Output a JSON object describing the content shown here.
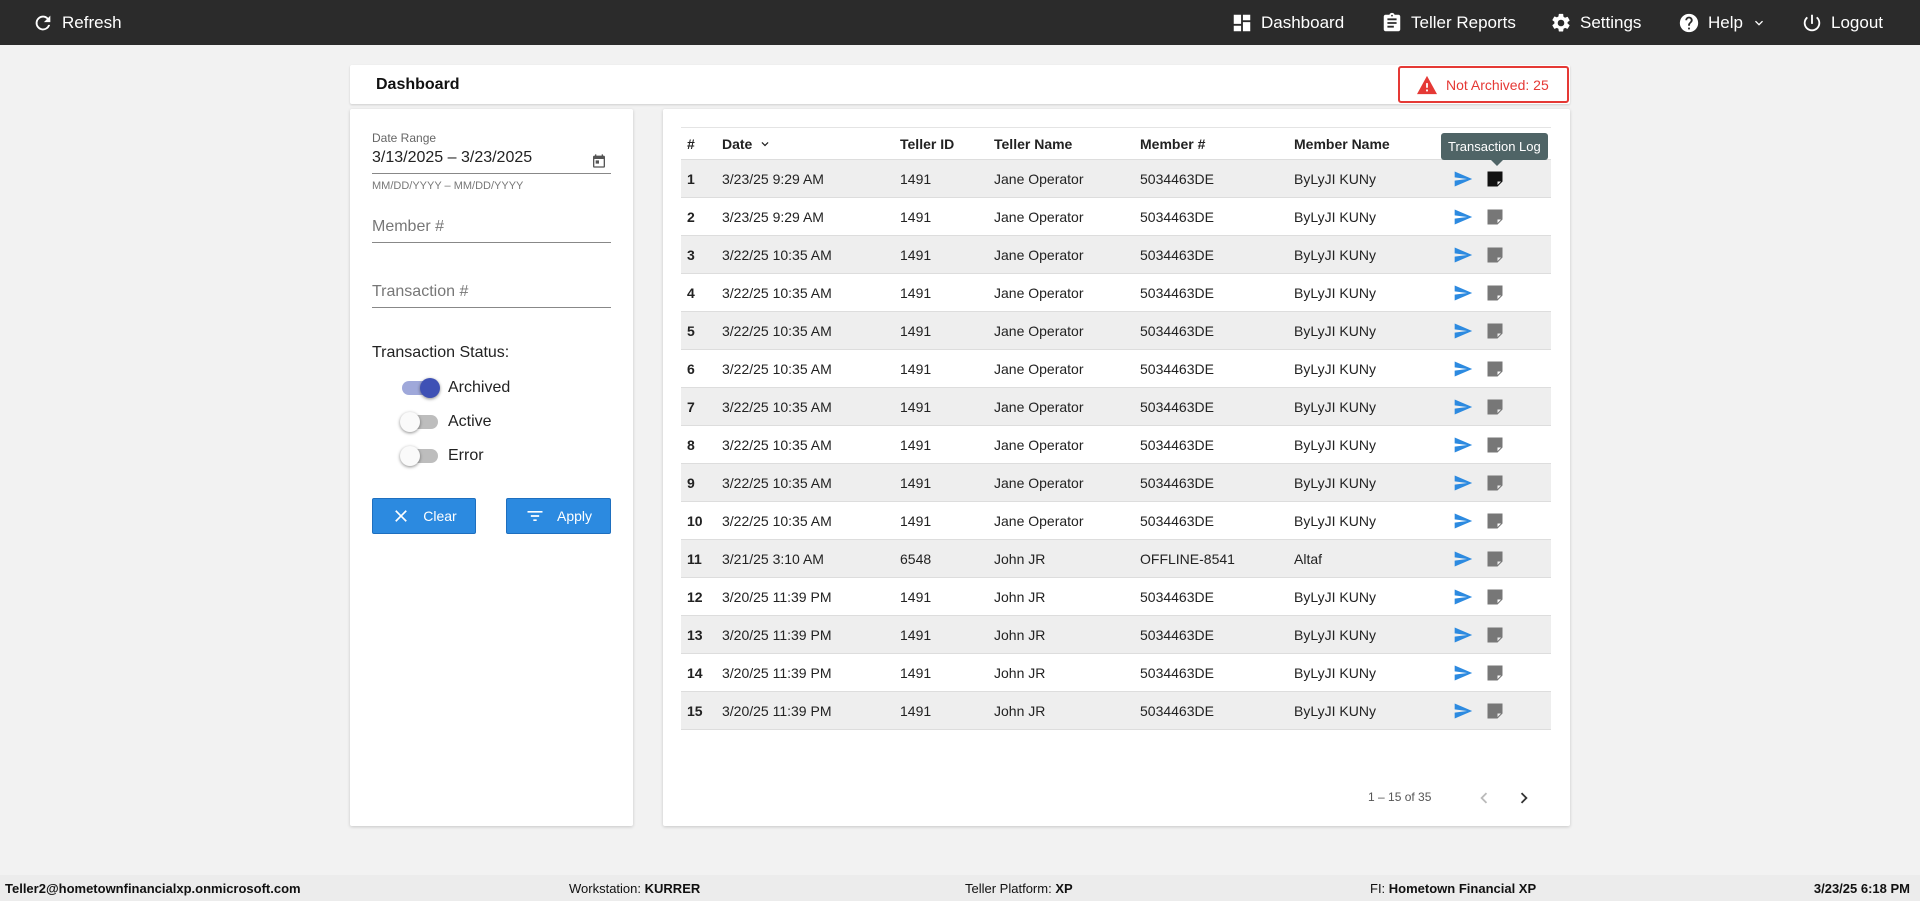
{
  "topbar": {
    "refresh_label": "Refresh",
    "dashboard_label": "Dashboard",
    "teller_reports_label": "Teller Reports",
    "settings_label": "Settings",
    "help_label": "Help",
    "logout_label": "Logout"
  },
  "header": {
    "title": "Dashboard",
    "alert_label": "Not Archived: 25",
    "alert_color": "#e53935"
  },
  "filters": {
    "date_range_label": "Date Range",
    "date_range_value": "3/13/2025 – 3/23/2025",
    "date_range_hint": "MM/DD/YYYY – MM/DD/YYYY",
    "member_placeholder": "Member #",
    "transaction_placeholder": "Transaction #",
    "status_label": "Transaction Status:",
    "statuses": [
      {
        "label": "Archived",
        "on": true
      },
      {
        "label": "Active",
        "on": false
      },
      {
        "label": "Error",
        "on": false
      }
    ],
    "clear_label": "Clear",
    "apply_label": "Apply"
  },
  "table": {
    "columns": [
      "#",
      "Date",
      "Teller ID",
      "Teller Name",
      "Member #",
      "Member Name"
    ],
    "tooltip": "Transaction Log",
    "rows": [
      [
        "1",
        "3/23/25 9:29 AM",
        "1491",
        "Jane Operator",
        "5034463DE",
        "ByLyJI KUNy"
      ],
      [
        "2",
        "3/23/25 9:29 AM",
        "1491",
        "Jane Operator",
        "5034463DE",
        "ByLyJI KUNy"
      ],
      [
        "3",
        "3/22/25 10:35 AM",
        "1491",
        "Jane Operator",
        "5034463DE",
        "ByLyJI KUNy"
      ],
      [
        "4",
        "3/22/25 10:35 AM",
        "1491",
        "Jane Operator",
        "5034463DE",
        "ByLyJI KUNy"
      ],
      [
        "5",
        "3/22/25 10:35 AM",
        "1491",
        "Jane Operator",
        "5034463DE",
        "ByLyJI KUNy"
      ],
      [
        "6",
        "3/22/25 10:35 AM",
        "1491",
        "Jane Operator",
        "5034463DE",
        "ByLyJI KUNy"
      ],
      [
        "7",
        "3/22/25 10:35 AM",
        "1491",
        "Jane Operator",
        "5034463DE",
        "ByLyJI KUNy"
      ],
      [
        "8",
        "3/22/25 10:35 AM",
        "1491",
        "Jane Operator",
        "5034463DE",
        "ByLyJI KUNy"
      ],
      [
        "9",
        "3/22/25 10:35 AM",
        "1491",
        "Jane Operator",
        "5034463DE",
        "ByLyJI KUNy"
      ],
      [
        "10",
        "3/22/25 10:35 AM",
        "1491",
        "Jane Operator",
        "5034463DE",
        "ByLyJI KUNy"
      ],
      [
        "11",
        "3/21/25 3:10 AM",
        "6548",
        "John JR",
        "OFFLINE-8541",
        "Altaf"
      ],
      [
        "12",
        "3/20/25 11:39 PM",
        "1491",
        "John JR",
        "5034463DE",
        "ByLyJI KUNy"
      ],
      [
        "13",
        "3/20/25 11:39 PM",
        "1491",
        "John JR",
        "5034463DE",
        "ByLyJI KUNy"
      ],
      [
        "14",
        "3/20/25 11:39 PM",
        "1491",
        "John JR",
        "5034463DE",
        "ByLyJI KUNy"
      ],
      [
        "15",
        "3/20/25 11:39 PM",
        "1491",
        "John JR",
        "5034463DE",
        "ByLyJI KUNy"
      ]
    ],
    "paginator_label": "1 – 15 of 35"
  },
  "footer": {
    "user": "Teller2@hometownfinancialxp.onmicrosoft.com",
    "workstation_label": "Workstation:",
    "workstation_value": "KURRER",
    "platform_label": "Teller Platform:",
    "platform_value": "XP",
    "fi_label": "FI:",
    "fi_value": "Hometown Financial XP",
    "datetime": "3/23/25 6:18 PM"
  },
  "colors": {
    "topbar_bg": "#2b2b2b",
    "accent_blue": "#2c8ae0",
    "toggle_on": "#3f51b5"
  },
  "icons": [
    "refresh-icon",
    "dashboard-icon",
    "clipboard-icon",
    "gear-icon",
    "help-icon",
    "power-icon",
    "warning-icon",
    "calendar-icon",
    "close-icon",
    "filter-icon",
    "send-icon",
    "note-icon",
    "chevron-left-icon",
    "chevron-right-icon"
  ]
}
